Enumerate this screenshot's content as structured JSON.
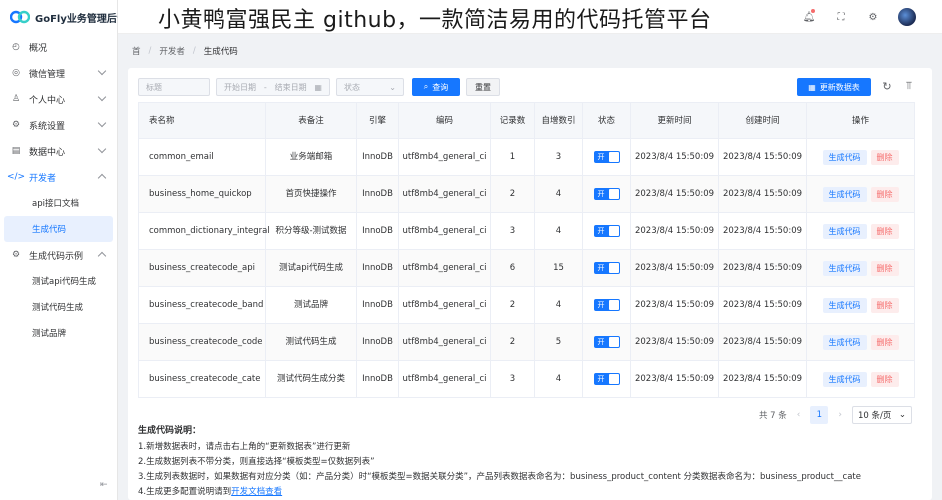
{
  "app": {
    "title": "GoFly业务管理后台"
  },
  "overlay_title": "小黄鸭富强民主 github，一款简洁易用的代码托管平台",
  "sidebar": {
    "items": [
      {
        "label": "概况",
        "icon": "dashboard-icon"
      },
      {
        "label": "微信管理",
        "icon": "wechat-icon"
      },
      {
        "label": "个人中心",
        "icon": "user-icon"
      },
      {
        "label": "系统设置",
        "icon": "gear-icon"
      },
      {
        "label": "数据中心",
        "icon": "database-icon"
      },
      {
        "label": "开发者",
        "icon": "code-icon"
      },
      {
        "label": "生成代码示例",
        "icon": "settings-icon"
      }
    ],
    "dev_sub": [
      "api接口文档",
      "生成代码"
    ],
    "example_sub": [
      "测试api代码生成",
      "测试代码生成",
      "测试品牌"
    ]
  },
  "breadcrumb": [
    "首",
    "开发者",
    "生成代码"
  ],
  "toolbar": {
    "title_placeholder": "标题",
    "date_start": "开始日期",
    "date_sep": "-",
    "date_end": "结束日期",
    "status_placeholder": "状态",
    "query": "查询",
    "reset": "重置",
    "refresh": "更新数据表"
  },
  "table": {
    "headers": [
      "表名称",
      "表备注",
      "引擎",
      "编码",
      "记录数",
      "自增数引",
      "状态",
      "更新时间",
      "创建时间",
      "操作"
    ],
    "rows": [
      {
        "name": "common_email",
        "remark": "业务端邮箱",
        "engine": "InnoDB",
        "charset": "utf8mb4_general_ci",
        "records": "1",
        "autoinc": "3",
        "status": "开",
        "updated": "2023/8/4 15:50:09",
        "created": "2023/8/4 15:50:09"
      },
      {
        "name": "business_home_quickop",
        "remark": "首页快捷操作",
        "engine": "InnoDB",
        "charset": "utf8mb4_general_ci",
        "records": "2",
        "autoinc": "4",
        "status": "开",
        "updated": "2023/8/4 15:50:09",
        "created": "2023/8/4 15:50:09"
      },
      {
        "name": "common_dictionary_integral",
        "remark": "积分等级-测试数据",
        "engine": "InnoDB",
        "charset": "utf8mb4_general_ci",
        "records": "3",
        "autoinc": "4",
        "status": "开",
        "updated": "2023/8/4 15:50:09",
        "created": "2023/8/4 15:50:09"
      },
      {
        "name": "business_createcode_api",
        "remark": "测试api代码生成",
        "engine": "InnoDB",
        "charset": "utf8mb4_general_ci",
        "records": "6",
        "autoinc": "15",
        "status": "开",
        "updated": "2023/8/4 15:50:09",
        "created": "2023/8/4 15:50:09"
      },
      {
        "name": "business_createcode_band",
        "remark": "测试品牌",
        "engine": "InnoDB",
        "charset": "utf8mb4_general_ci",
        "records": "2",
        "autoinc": "4",
        "status": "开",
        "updated": "2023/8/4 15:50:09",
        "created": "2023/8/4 15:50:09"
      },
      {
        "name": "business_createcode_code",
        "remark": "测试代码生成",
        "engine": "InnoDB",
        "charset": "utf8mb4_general_ci",
        "records": "2",
        "autoinc": "5",
        "status": "开",
        "updated": "2023/8/4 15:50:09",
        "created": "2023/8/4 15:50:09"
      },
      {
        "name": "business_createcode_cate",
        "remark": "测试代码生成分类",
        "engine": "InnoDB",
        "charset": "utf8mb4_general_ci",
        "records": "3",
        "autoinc": "4",
        "status": "开",
        "updated": "2023/8/4 15:50:09",
        "created": "2023/8/4 15:50:09"
      }
    ],
    "op_generate": "生成代码",
    "op_delete": "删除"
  },
  "pager": {
    "total": "共 7 条",
    "page": "1",
    "size": "10 条/页"
  },
  "notes": {
    "title": "生成代码说明：",
    "lines": [
      "1.新增数据表时，请点击右上角的“更新数据表”进行更新",
      "2.生成数据列表不带分类，则直接选择“模板类型=仅数据列表”",
      "3.生成列表数据时，如果数据有对应分类（如：产品分类）时“模板类型=数据关联分类”，产品列表数据表命名为：business_product_content 分类数据表命名为：business_product__cate"
    ],
    "line4_prefix": "4.生成更多配置说明请到",
    "line4_link": "开发文档查看"
  },
  "colors": {
    "primary": "#1677ff",
    "danger": "#f56c6c"
  }
}
